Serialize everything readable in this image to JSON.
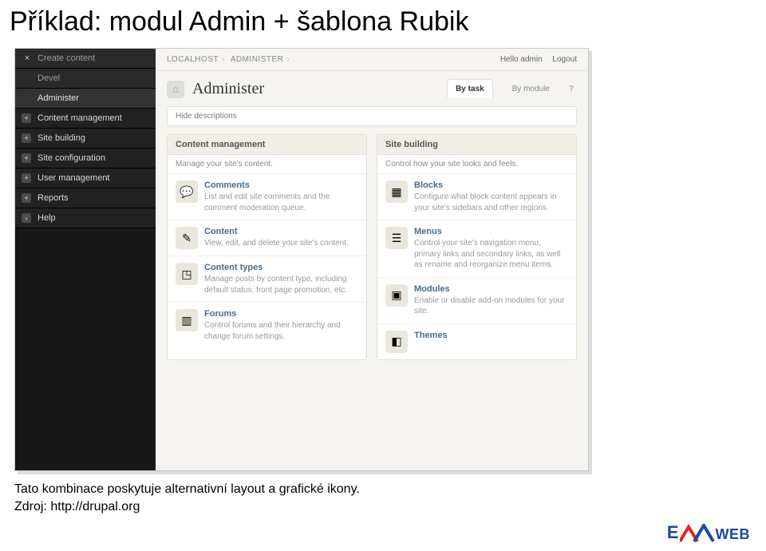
{
  "slide": {
    "title": "Příklad: modul Admin + šablona Rubik",
    "caption_line1": "Tato kombinace poskytuje alternativní layout a grafické ikony.",
    "caption_line2": "Zdroj: http://drupal.org"
  },
  "sidebar": {
    "top": [
      "Create content",
      "Devel",
      "Administer"
    ],
    "items": [
      "Content management",
      "Site building",
      "Site configuration",
      "User management",
      "Reports",
      "Help"
    ]
  },
  "header": {
    "breadcrumb": [
      "LOCALHOST",
      "ADMINISTER"
    ],
    "greeting": "Hello admin",
    "logout": "Logout",
    "title": "Administer",
    "tabs": [
      "By task",
      "By module"
    ],
    "help": "?"
  },
  "body": {
    "hide_desc": "Hide descriptions",
    "panels": [
      {
        "title": "Content management",
        "sub": "Manage your site's content.",
        "items": [
          {
            "title": "Comments",
            "desc": "List and edit site comments and the comment moderation queue."
          },
          {
            "title": "Content",
            "desc": "View, edit, and delete your site's content."
          },
          {
            "title": "Content types",
            "desc": "Manage posts by content type, including default status, front page promotion, etc."
          },
          {
            "title": "Forums",
            "desc": "Control forums and their hierarchy and change forum settings."
          }
        ]
      },
      {
        "title": "Site building",
        "sub": "Control how your site looks and feels.",
        "items": [
          {
            "title": "Blocks",
            "desc": "Configure what block content appears in your site's sidebars and other regions."
          },
          {
            "title": "Menus",
            "desc": "Control your site's navigation menu, primary links and secondary links, as well as rename and reorganize menu items."
          },
          {
            "title": "Modules",
            "desc": "Enable or disable add-on modules for your site."
          },
          {
            "title": "Themes",
            "desc": ""
          }
        ]
      }
    ]
  }
}
